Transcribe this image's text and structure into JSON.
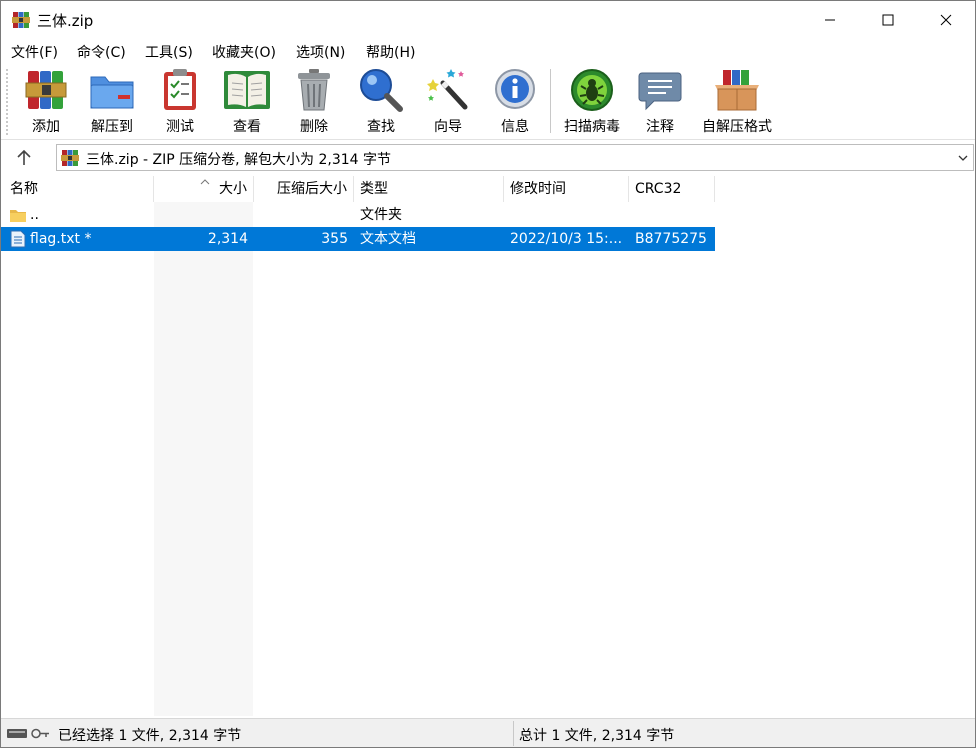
{
  "window": {
    "title": "三体.zip"
  },
  "menu": [
    {
      "label": "文件(F)"
    },
    {
      "label": "命令(C)"
    },
    {
      "label": "工具(S)"
    },
    {
      "label": "收藏夹(O)"
    },
    {
      "label": "选项(N)"
    },
    {
      "label": "帮助(H)"
    }
  ],
  "toolbar": [
    {
      "label": "添加",
      "icon": "add-archive-icon"
    },
    {
      "label": "解压到",
      "icon": "extract-folder-icon"
    },
    {
      "label": "测试",
      "icon": "test-clipboard-icon"
    },
    {
      "label": "查看",
      "icon": "view-book-icon"
    },
    {
      "label": "删除",
      "icon": "trash-icon"
    },
    {
      "label": "查找",
      "icon": "magnifier-icon"
    },
    {
      "label": "向导",
      "icon": "magic-wand-icon"
    },
    {
      "label": "信息",
      "icon": "info-icon"
    },
    {
      "label": "扫描病毒",
      "icon": "virus-scan-icon"
    },
    {
      "label": "注释",
      "icon": "comment-icon"
    },
    {
      "label": "自解压格式",
      "icon": "sfx-box-icon"
    }
  ],
  "address": {
    "text": "三体.zip - ZIP 压缩分卷, 解包大小为 2,314 字节"
  },
  "columns": [
    "名称",
    "大小",
    "压缩后大小",
    "类型",
    "修改时间",
    "CRC32"
  ],
  "files": [
    {
      "name": "..",
      "size": "",
      "packed": "",
      "type": "文件夹",
      "modified": "",
      "crc": "",
      "icon": "folder-icon",
      "selected": false
    },
    {
      "name": "flag.txt *",
      "size": "2,314",
      "packed": "355",
      "type": "文本文档",
      "modified": "2022/10/3 15:...",
      "crc": "B8775275",
      "icon": "text-file-icon",
      "selected": true
    }
  ],
  "status": {
    "left": "已经选择 1 文件, 2,314 字节",
    "right": "总计 1 文件, 2,314 字节"
  },
  "colors": {
    "selection": "#0078d7"
  }
}
